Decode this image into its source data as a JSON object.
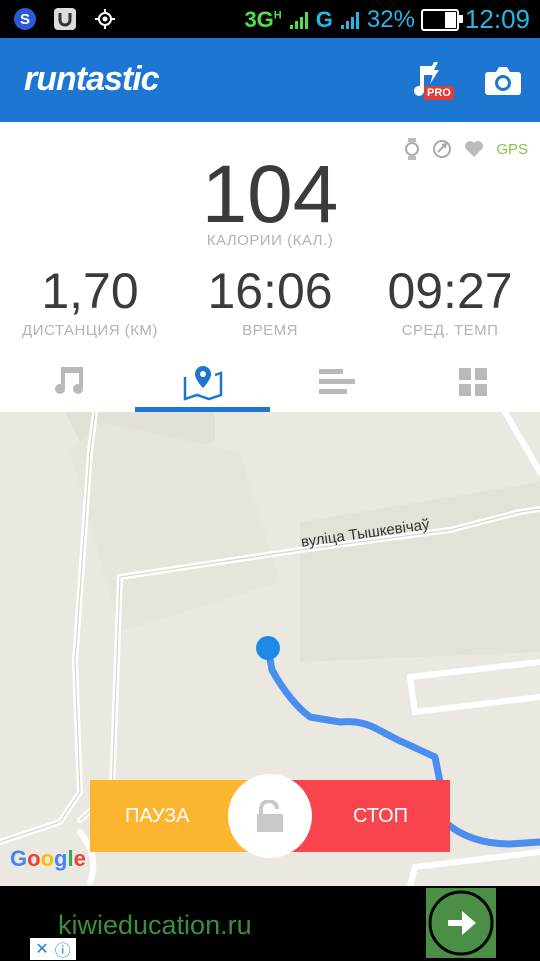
{
  "status_bar": {
    "network": "3G",
    "network_sup": "H",
    "network2": "G",
    "battery": "32%",
    "battery_level": 0.32,
    "time": "12:09"
  },
  "app_bar": {
    "brand": "runtastic",
    "pro_badge": "PRO"
  },
  "sensors": {
    "gps": "GPS"
  },
  "calories": {
    "value": "104",
    "label": "КАЛОРИИ (КАЛ.)"
  },
  "metrics": [
    {
      "value": "1,70",
      "label": "ДИСТАНЦИЯ (КМ)"
    },
    {
      "value": "16:06",
      "label": "ВРЕМЯ"
    },
    {
      "value": "09:27",
      "label": "СРЕД. ТЕМП"
    }
  ],
  "tabs": {
    "active": "map",
    "items": [
      "music",
      "map",
      "stats",
      "dashboard"
    ]
  },
  "map": {
    "street": "вуліца Тышкевічаў",
    "attribution": "Google",
    "colors": {
      "route": "#4a8ff0",
      "marker": "#1e88e5",
      "road": "#ffffff",
      "land": "#ebe8e1"
    }
  },
  "controls": {
    "pause": "ПАУЗА",
    "stop": "СТОП"
  },
  "ad": {
    "text": "kiwieducation.ru"
  },
  "colors": {
    "primary": "#1d76d2",
    "pause": "#fbb52f",
    "stop": "#f8454d",
    "gps": "#8bc34a"
  }
}
